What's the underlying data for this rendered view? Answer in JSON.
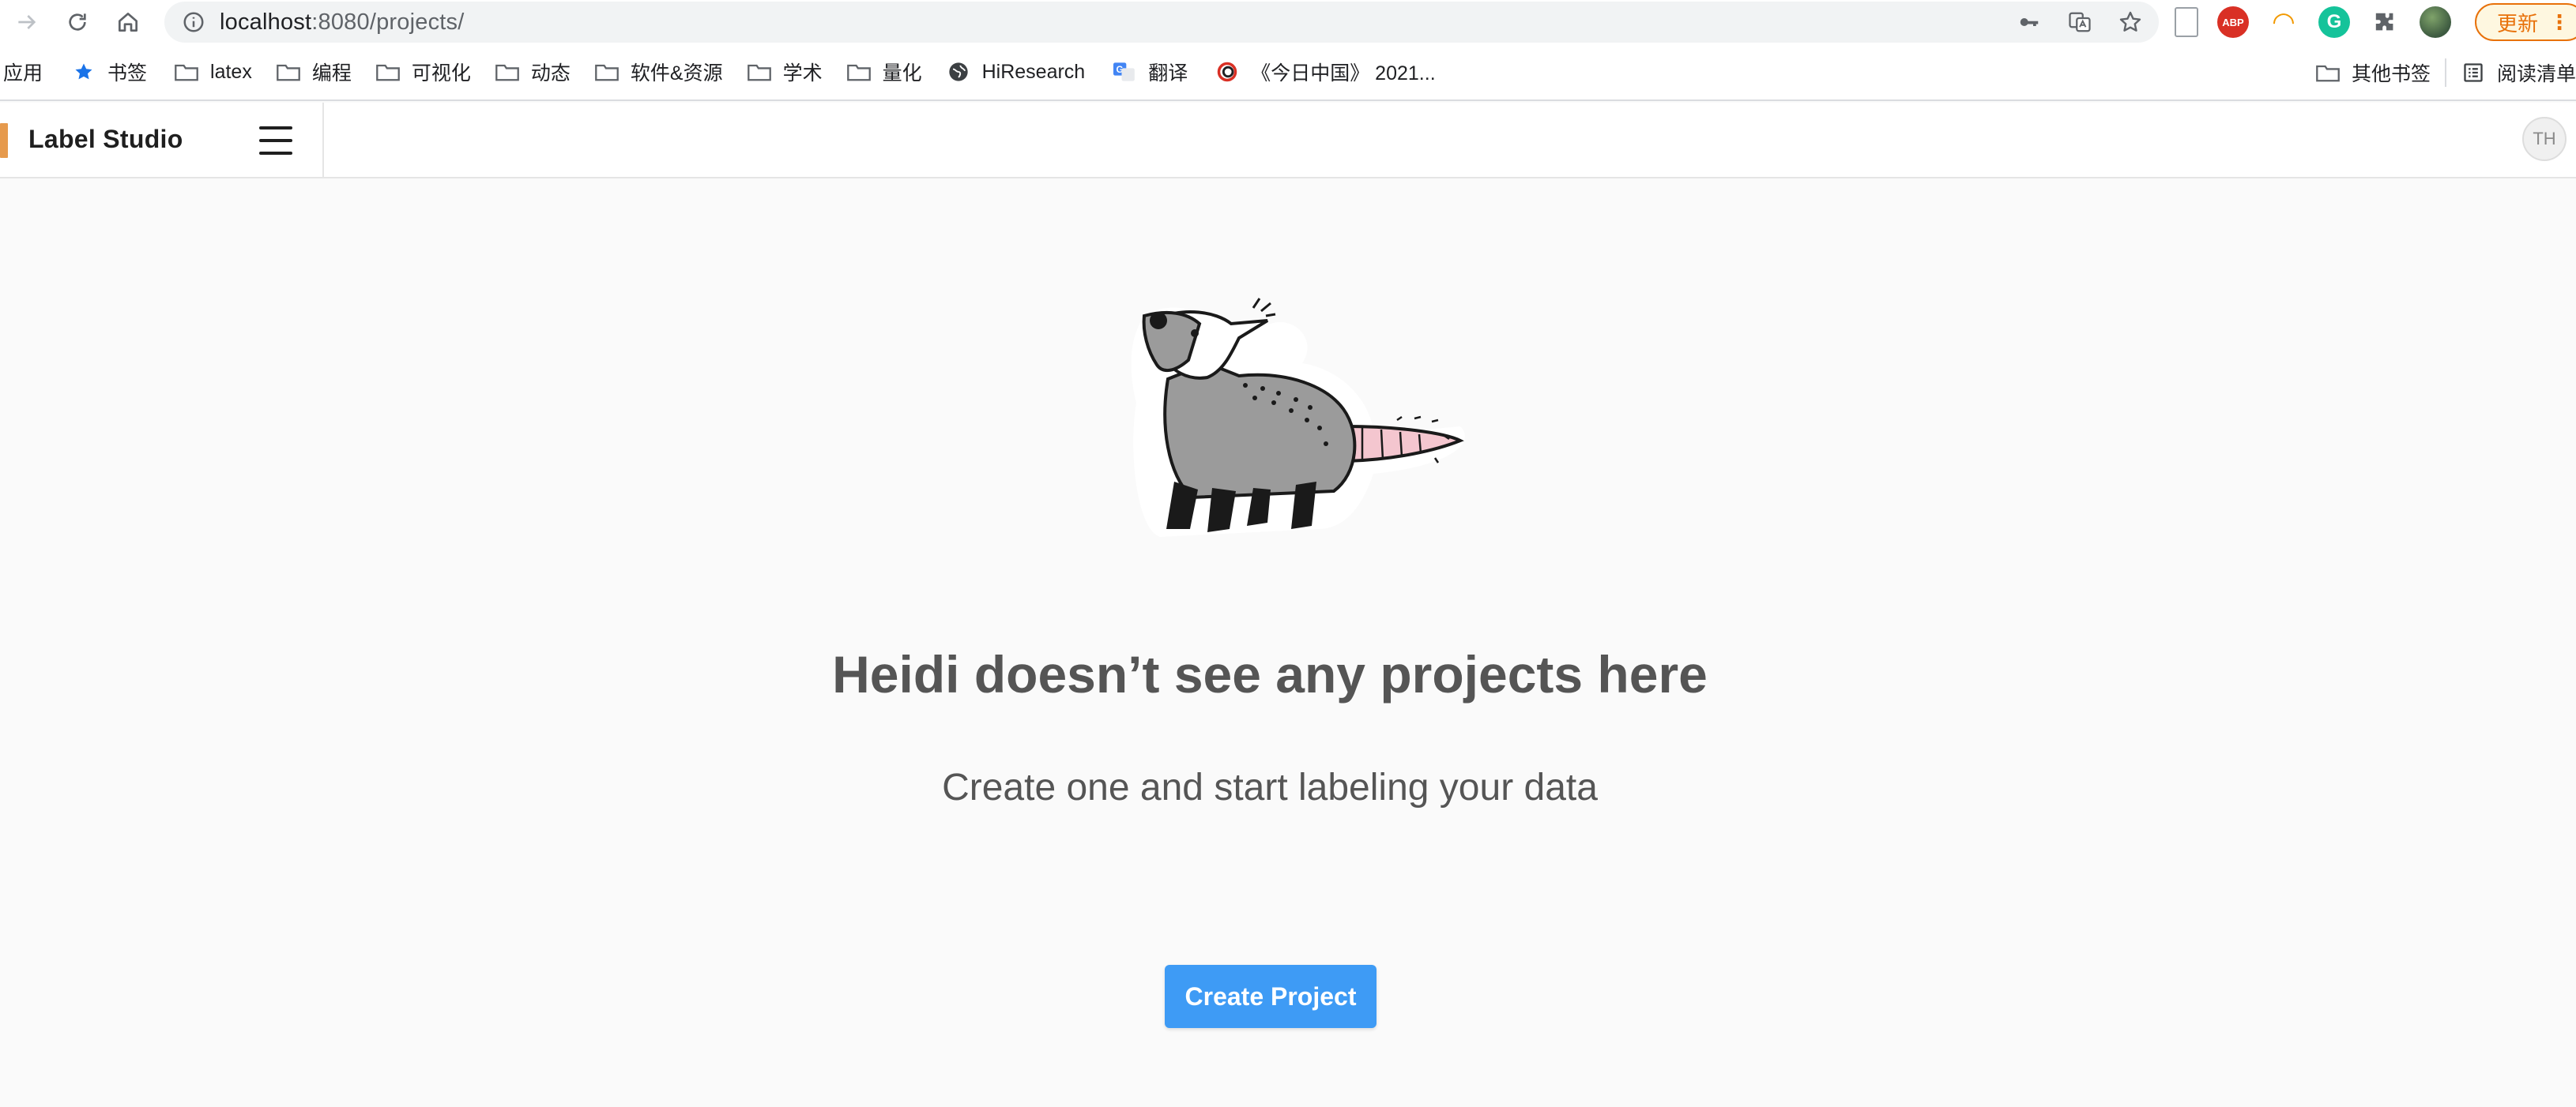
{
  "browser": {
    "url_host": "localhost",
    "url_path": ":8080/projects/",
    "update_label": "更新",
    "update_more": "⋮",
    "bookmarks": [
      {
        "label": "应用",
        "icon": "apps-icon"
      },
      {
        "label": "书签",
        "icon": "star-icon"
      },
      {
        "label": "latex",
        "icon": "folder-icon"
      },
      {
        "label": "编程",
        "icon": "folder-icon"
      },
      {
        "label": "可视化",
        "icon": "folder-icon"
      },
      {
        "label": "动态",
        "icon": "folder-icon"
      },
      {
        "label": "软件&资源",
        "icon": "folder-icon"
      },
      {
        "label": "学术",
        "icon": "folder-icon"
      },
      {
        "label": "量化",
        "icon": "folder-icon"
      },
      {
        "label": "HiResearch",
        "icon": "globe-icon"
      },
      {
        "label": "翻译",
        "icon": "translate-icon"
      },
      {
        "label": "《今日中国》 2021...",
        "icon": "china-today-icon"
      }
    ],
    "bookmarks_right": [
      {
        "label": "其他书签",
        "icon": "folder-icon"
      },
      {
        "label": "阅读清单",
        "icon": "reading-list-icon"
      }
    ]
  },
  "app": {
    "name": "Label Studio",
    "user_initials": "TH",
    "brand_color": "#e69a4d"
  },
  "empty_state": {
    "title": "Heidi doesn’t see any projects here",
    "subtitle": "Create one and start labeling your data",
    "button_label": "Create Project",
    "button_color": "#3e9bf5"
  }
}
